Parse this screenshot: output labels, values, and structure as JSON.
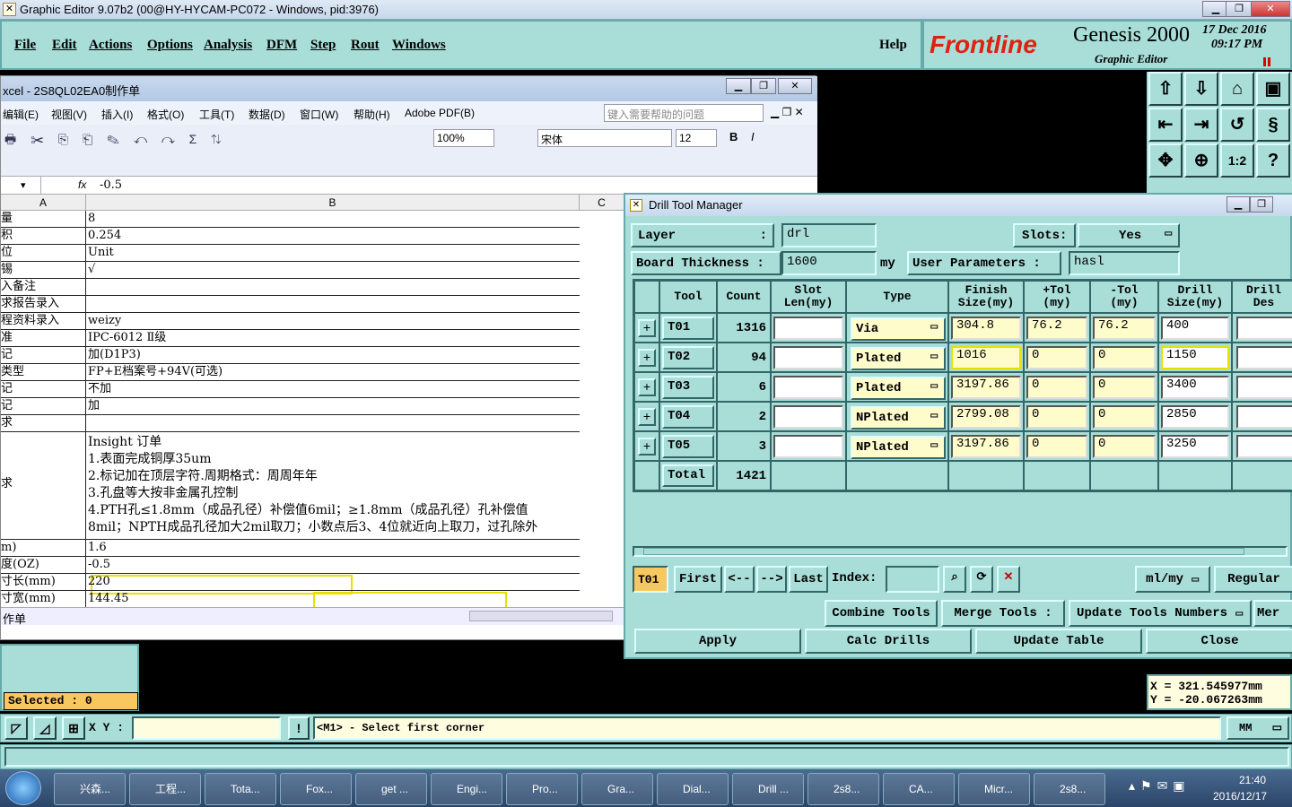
{
  "app": {
    "title": "Graphic Editor 9.07b2 (00@HY-HYCAM-PC072 - Windows, pid:3976)",
    "menus": [
      "File",
      "Edit",
      "Actions",
      "Options",
      "Analysis",
      "DFM",
      "Step",
      "Rout",
      "Windows"
    ],
    "help": "Help",
    "brand": "Frontline",
    "product": "Genesis 2000",
    "subtitle": "Graphic Editor",
    "date": "17 Dec 2016",
    "time": "09:17 PM"
  },
  "excel": {
    "title": "xcel - 2S8QL02EA0制作单",
    "menus": [
      "编辑(E)",
      "视图(V)",
      "插入(I)",
      "格式(O)",
      "工具(T)",
      "数据(D)",
      "窗口(W)",
      "帮助(H)",
      "Adobe PDF(B)"
    ],
    "help_placeholder": "键入需要帮助的问题",
    "zoom": "100%",
    "font": "宋体",
    "font_size": "12",
    "formula_fx": "fx",
    "formula_value": "-0.5",
    "col_a": "A",
    "col_b": "B",
    "col_c": "C",
    "sheet_tab": "作单",
    "rows": [
      {
        "a": "量",
        "b": "8"
      },
      {
        "a": "积",
        "b": "0.254"
      },
      {
        "a": "位",
        "b": "Unit"
      },
      {
        "a": "锡",
        "b": "√"
      },
      {
        "a": "入备注",
        "b": ""
      },
      {
        "a": "求报告录入",
        "b": ""
      },
      {
        "a": "程资料录入",
        "b": "weizy"
      },
      {
        "a": "准",
        "b": "IPC-6012 Ⅱ级"
      },
      {
        "a": "记",
        "b": "加(D1P3)"
      },
      {
        "a": "类型",
        "b": "FP+E档案号+94V(可选)"
      },
      {
        "a": "记",
        "b": "不加"
      },
      {
        "a": "记",
        "b": "加"
      },
      {
        "a": "求",
        "b": ""
      }
    ],
    "notes_label": "求",
    "notes": [
      "Insight 订单",
      "1.表面完成铜厚35um",
      "2.标记加在顶层字符.周期格式：周周年年",
      "3.孔盘等大按非金属孔控制",
      "4.PTH孔≤1.8mm（成品孔径）补偿值6mil；≥1.8mm（成品孔径）孔补偿值",
      "8mil；NPTH成品孔径加大2mil取刀；小数点后3、4位就近向上取刀，过孔除外"
    ],
    "rows_after": [
      {
        "a": "m)",
        "b": "1.6"
      },
      {
        "a": "度(OZ)",
        "b": "-0.5"
      },
      {
        "a": "寸长(mm)",
        "b": "220"
      },
      {
        "a": "寸宽(mm)",
        "b": "144.45"
      }
    ]
  },
  "drill": {
    "title": "Drill Tool Manager",
    "layer_label": "Layer",
    "layer_value": "drl",
    "slots_label": "Slots:",
    "slots_value": "Yes",
    "thickness_label": "Board Thickness :",
    "thickness_value": "1600",
    "thickness_unit": "my",
    "user_params_label": "User Parameters :",
    "user_params_value": "hasl",
    "headers": [
      "Tool",
      "Count",
      "Slot Len(my)",
      "Type",
      "Finish Size(my)",
      "+Tol (my)",
      "-Tol (my)",
      "Drill Size(my)",
      "Drill Des"
    ],
    "rows": [
      {
        "tool": "T01",
        "count": "1316",
        "slot": "",
        "type": "Via",
        "finish": "304.8",
        "ptol": "76.2",
        "mtol": "76.2",
        "drill": "400"
      },
      {
        "tool": "T02",
        "count": "94",
        "slot": "",
        "type": "Plated",
        "finish": "1016",
        "ptol": "0",
        "mtol": "0",
        "drill": "1150"
      },
      {
        "tool": "T03",
        "count": "6",
        "slot": "",
        "type": "Plated",
        "finish": "3197.86",
        "ptol": "0",
        "mtol": "0",
        "drill": "3400"
      },
      {
        "tool": "T04",
        "count": "2",
        "slot": "",
        "type": "NPlated",
        "finish": "2799.08",
        "ptol": "0",
        "mtol": "0",
        "drill": "2850"
      },
      {
        "tool": "T05",
        "count": "3",
        "slot": "",
        "type": "NPlated",
        "finish": "3197.86",
        "ptol": "0",
        "mtol": "0",
        "drill": "3250"
      }
    ],
    "total_label": "Total",
    "total_count": "1421",
    "nav_current": "T01",
    "nav_first": "First",
    "nav_prev": "<--",
    "nav_next": "-->",
    "nav_last": "Last",
    "index_label": "Index:",
    "units": "ml/my",
    "mode": "Regular",
    "combine": "Combine Tools",
    "merge": "Merge Tools :",
    "update_numbers": "Update Tools Numbers",
    "mer": "Mer",
    "apply": "Apply",
    "calc": "Calc Drills",
    "update_table": "Update Table",
    "close": "Close"
  },
  "status": {
    "selected": "Selected : 0",
    "xy_label": "X Y :",
    "prompt": "<M1> - Select first corner",
    "units": "MM",
    "x": "X  = 321.545977mm",
    "y": "Y  = -20.067263mm"
  },
  "taskbar": {
    "items": [
      "兴森...",
      "工程...",
      "Tota...",
      "Fox...",
      "get ...",
      "Engi...",
      "Pro...",
      "Gra...",
      "Dial...",
      "Drill ...",
      "2s8...",
      "CA...",
      "Micr...",
      "2s8..."
    ],
    "clock_time": "21:40",
    "clock_date": "2016/12/17"
  }
}
